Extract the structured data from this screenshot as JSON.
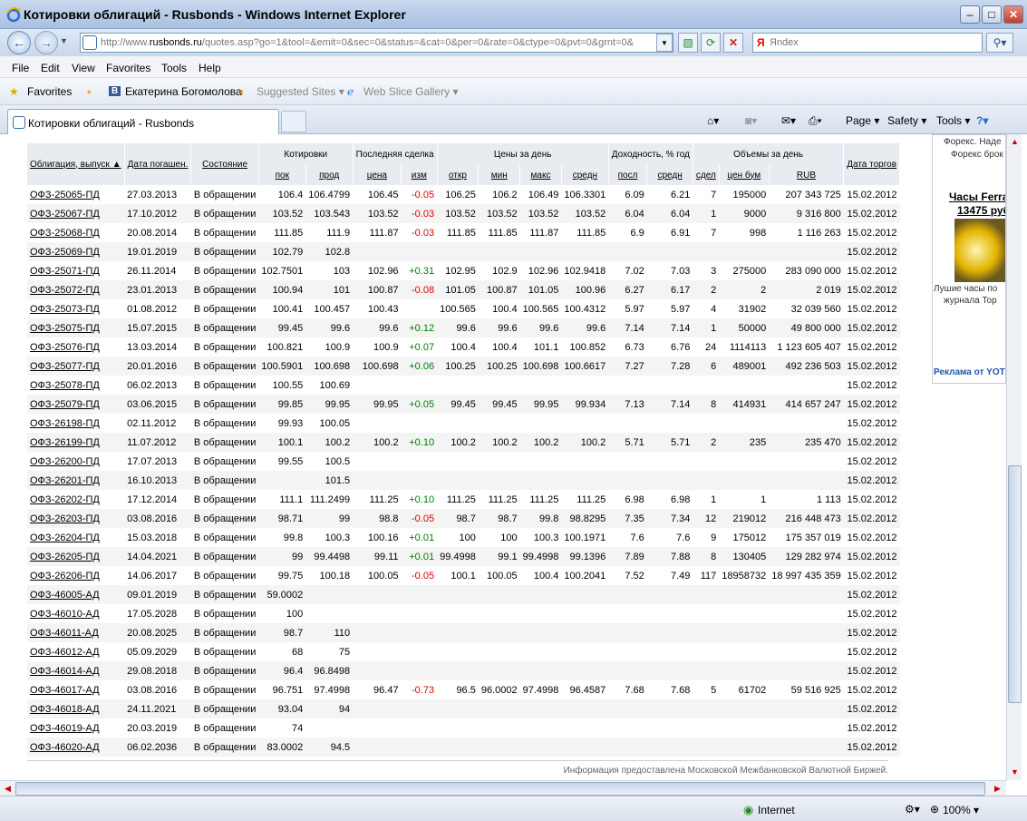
{
  "window": {
    "title": "Котировки облигаций - Rusbonds - Windows Internet Explorer"
  },
  "address": {
    "url_prefix": "http://www.",
    "url_domain": "rusbonds.ru",
    "url_rest": "/quotes.asp?go=1&tool=&emit=0&sec=0&status=&cat=0&per=0&rate=0&ctype=0&pvt=0&grnt=0&",
    "search_placeholder": "Яndex"
  },
  "menu": [
    "File",
    "Edit",
    "View",
    "Favorites",
    "Tools",
    "Help"
  ],
  "favorites": {
    "label": "Favorites",
    "items": [
      "Екатерина Богомолова",
      "Suggested Sites ▾",
      "Web Slice Gallery ▾"
    ]
  },
  "tab": {
    "label": "Котировки облигаций - Rusbonds"
  },
  "commands": {
    "page": "Page ▾",
    "safety": "Safety ▾",
    "tools": "Tools ▾"
  },
  "table": {
    "headers": {
      "bond": "Облигация, выпуск ▲",
      "maturity": "Дата погашен.",
      "state": "Состояние",
      "quotes": "Котировки",
      "last_deal": "Последняя сделка",
      "day_prices": "Цены за день",
      "yield": "Доходность, % год",
      "volumes": "Объемы за день",
      "trade_date": "Дата торгов",
      "bid": "пок",
      "ask": "прод",
      "price": "цена",
      "change": "изм",
      "open": "откр",
      "min": "мин",
      "max": "макс",
      "avg": "средн",
      "y_last": "посл",
      "y_avg": "средн",
      "deals": "сдел",
      "vol_face": "цен бум",
      "vol_rub": "RUB"
    },
    "rows": [
      [
        "ОФЗ-25065-ПД",
        "27.03.2013",
        "В обращении",
        "106.4",
        "106.4799",
        "106.45",
        "-0.05",
        "106.25",
        "106.2",
        "106.49",
        "106.3301",
        "6.09",
        "6.21",
        "7",
        "195000",
        "207 343 725",
        "15.02.2012"
      ],
      [
        "ОФЗ-25067-ПД",
        "17.10.2012",
        "В обращении",
        "103.52",
        "103.543",
        "103.52",
        "-0.03",
        "103.52",
        "103.52",
        "103.52",
        "103.52",
        "6.04",
        "6.04",
        "1",
        "9000",
        "9 316 800",
        "15.02.2012"
      ],
      [
        "ОФЗ-25068-ПД",
        "20.08.2014",
        "В обращении",
        "111.85",
        "111.9",
        "111.87",
        "-0.03",
        "111.85",
        "111.85",
        "111.87",
        "111.85",
        "6.9",
        "6.91",
        "7",
        "998",
        "1 116 263",
        "15.02.2012"
      ],
      [
        "ОФЗ-25069-ПД",
        "19.01.2019",
        "В обращении",
        "102.79",
        "102.8",
        "",
        "",
        "",
        "",
        "",
        "",
        "",
        "",
        "",
        "",
        "",
        "15.02.2012"
      ],
      [
        "ОФЗ-25071-ПД",
        "26.11.2014",
        "В обращении",
        "102.7501",
        "103",
        "102.96",
        "+0.31",
        "102.95",
        "102.9",
        "102.96",
        "102.9418",
        "7.02",
        "7.03",
        "3",
        "275000",
        "283 090 000",
        "15.02.2012"
      ],
      [
        "ОФЗ-25072-ПД",
        "23.01.2013",
        "В обращении",
        "100.94",
        "101",
        "100.87",
        "-0.08",
        "101.05",
        "100.87",
        "101.05",
        "100.96",
        "6.27",
        "6.17",
        "2",
        "2",
        "2 019",
        "15.02.2012"
      ],
      [
        "ОФЗ-25073-ПД",
        "01.08.2012",
        "В обращении",
        "100.41",
        "100.457",
        "100.43",
        "",
        "100.565",
        "100.4",
        "100.565",
        "100.4312",
        "5.97",
        "5.97",
        "4",
        "31902",
        "32 039 560",
        "15.02.2012"
      ],
      [
        "ОФЗ-25075-ПД",
        "15.07.2015",
        "В обращении",
        "99.45",
        "99.6",
        "99.6",
        "+0.12",
        "99.6",
        "99.6",
        "99.6",
        "99.6",
        "7.14",
        "7.14",
        "1",
        "50000",
        "49 800 000",
        "15.02.2012"
      ],
      [
        "ОФЗ-25076-ПД",
        "13.03.2014",
        "В обращении",
        "100.821",
        "100.9",
        "100.9",
        "+0.07",
        "100.4",
        "100.4",
        "101.1",
        "100.852",
        "6.73",
        "6.76",
        "24",
        "1114113",
        "1 123 605 407",
        "15.02.2012"
      ],
      [
        "ОФЗ-25077-ПД",
        "20.01.2016",
        "В обращении",
        "100.5901",
        "100.698",
        "100.698",
        "+0.06",
        "100.25",
        "100.25",
        "100.698",
        "100.6617",
        "7.27",
        "7.28",
        "6",
        "489001",
        "492 236 503",
        "15.02.2012"
      ],
      [
        "ОФЗ-25078-ПД",
        "06.02.2013",
        "В обращении",
        "100.55",
        "100.69",
        "",
        "",
        "",
        "",
        "",
        "",
        "",
        "",
        "",
        "",
        "",
        "15.02.2012"
      ],
      [
        "ОФЗ-25079-ПД",
        "03.06.2015",
        "В обращении",
        "99.85",
        "99.95",
        "99.95",
        "+0.05",
        "99.45",
        "99.45",
        "99.95",
        "99.934",
        "7.13",
        "7.14",
        "8",
        "414931",
        "414 657 247",
        "15.02.2012"
      ],
      [
        "ОФЗ-26198-ПД",
        "02.11.2012",
        "В обращении",
        "99.93",
        "100.05",
        "",
        "",
        "",
        "",
        "",
        "",
        "",
        "",
        "",
        "",
        "",
        "15.02.2012"
      ],
      [
        "ОФЗ-26199-ПД",
        "11.07.2012",
        "В обращении",
        "100.1",
        "100.2",
        "100.2",
        "+0.10",
        "100.2",
        "100.2",
        "100.2",
        "100.2",
        "5.71",
        "5.71",
        "2",
        "235",
        "235 470",
        "15.02.2012"
      ],
      [
        "ОФЗ-26200-ПД",
        "17.07.2013",
        "В обращении",
        "99.55",
        "100.5",
        "",
        "",
        "",
        "",
        "",
        "",
        "",
        "",
        "",
        "",
        "",
        "15.02.2012"
      ],
      [
        "ОФЗ-26201-ПД",
        "16.10.2013",
        "В обращении",
        "",
        "101.5",
        "",
        "",
        "",
        "",
        "",
        "",
        "",
        "",
        "",
        "",
        "",
        "15.02.2012"
      ],
      [
        "ОФЗ-26202-ПД",
        "17.12.2014",
        "В обращении",
        "111.1",
        "111.2499",
        "111.25",
        "+0.10",
        "111.25",
        "111.25",
        "111.25",
        "111.25",
        "6.98",
        "6.98",
        "1",
        "1",
        "1 113",
        "15.02.2012"
      ],
      [
        "ОФЗ-26203-ПД",
        "03.08.2016",
        "В обращении",
        "98.71",
        "99",
        "98.8",
        "-0.05",
        "98.7",
        "98.7",
        "99.8",
        "98.8295",
        "7.35",
        "7.34",
        "12",
        "219012",
        "216 448 473",
        "15.02.2012"
      ],
      [
        "ОФЗ-26204-ПД",
        "15.03.2018",
        "В обращении",
        "99.8",
        "100.3",
        "100.16",
        "+0.01",
        "100",
        "100",
        "100.3",
        "100.1971",
        "7.6",
        "7.6",
        "9",
        "175012",
        "175 357 019",
        "15.02.2012"
      ],
      [
        "ОФЗ-26205-ПД",
        "14.04.2021",
        "В обращении",
        "99",
        "99.4498",
        "99.11",
        "+0.01",
        "99.4998",
        "99.1",
        "99.4998",
        "99.1396",
        "7.89",
        "7.88",
        "8",
        "130405",
        "129 282 974",
        "15.02.2012"
      ],
      [
        "ОФЗ-26206-ПД",
        "14.06.2017",
        "В обращении",
        "99.75",
        "100.18",
        "100.05",
        "-0.05",
        "100.1",
        "100.05",
        "100.4",
        "100.2041",
        "7.52",
        "7.49",
        "117",
        "18958732",
        "18 997 435 359",
        "15.02.2012"
      ],
      [
        "ОФЗ-46005-АД",
        "09.01.2019",
        "В обращении",
        "59.0002",
        "",
        "",
        "",
        "",
        "",
        "",
        "",
        "",
        "",
        "",
        "",
        "",
        "15.02.2012"
      ],
      [
        "ОФЗ-46010-АД",
        "17.05.2028",
        "В обращении",
        "100",
        "",
        "",
        "",
        "",
        "",
        "",
        "",
        "",
        "",
        "",
        "",
        "",
        "15.02.2012"
      ],
      [
        "ОФЗ-46011-АД",
        "20.08.2025",
        "В обращении",
        "98.7",
        "110",
        "",
        "",
        "",
        "",
        "",
        "",
        "",
        "",
        "",
        "",
        "",
        "15.02.2012"
      ],
      [
        "ОФЗ-46012-АД",
        "05.09.2029",
        "В обращении",
        "68",
        "75",
        "",
        "",
        "",
        "",
        "",
        "",
        "",
        "",
        "",
        "",
        "",
        "15.02.2012"
      ],
      [
        "ОФЗ-46014-АД",
        "29.08.2018",
        "В обращении",
        "96.4",
        "96.8498",
        "",
        "",
        "",
        "",
        "",
        "",
        "",
        "",
        "",
        "",
        "",
        "15.02.2012"
      ],
      [
        "ОФЗ-46017-АД",
        "03.08.2016",
        "В обращении",
        "96.751",
        "97.4998",
        "96.47",
        "-0.73",
        "96.5",
        "96.0002",
        "97.4998",
        "96.4587",
        "7.68",
        "7.68",
        "5",
        "61702",
        "59 516 925",
        "15.02.2012"
      ],
      [
        "ОФЗ-46018-АД",
        "24.11.2021",
        "В обращении",
        "93.04",
        "94",
        "",
        "",
        "",
        "",
        "",
        "",
        "",
        "",
        "",
        "",
        "",
        "15.02.2012"
      ],
      [
        "ОФЗ-46019-АД",
        "20.03.2019",
        "В обращении",
        "74",
        "",
        "",
        "",
        "",
        "",
        "",
        "",
        "",
        "",
        "",
        "",
        "",
        "15.02.2012"
      ],
      [
        "ОФЗ-46020-АД",
        "06.02.2036",
        "В обращении",
        "83.0002",
        "94.5",
        "",
        "",
        "",
        "",
        "",
        "",
        "",
        "",
        "",
        "",
        "",
        "15.02.2012"
      ]
    ],
    "source": "Информация предоставлена Московской Межбанковской Валютной Биржей."
  },
  "ad": {
    "line1": "Форекс. Наде",
    "line2": "Форекс брок",
    "headline1": "Часы Ferra",
    "headline2": "13475 руб",
    "desc1": "Лушие часы по",
    "desc2": "журнала Top",
    "label": "Реклама от YOTT"
  },
  "status": {
    "zone": "Internet",
    "zoom": "100% ▾"
  }
}
